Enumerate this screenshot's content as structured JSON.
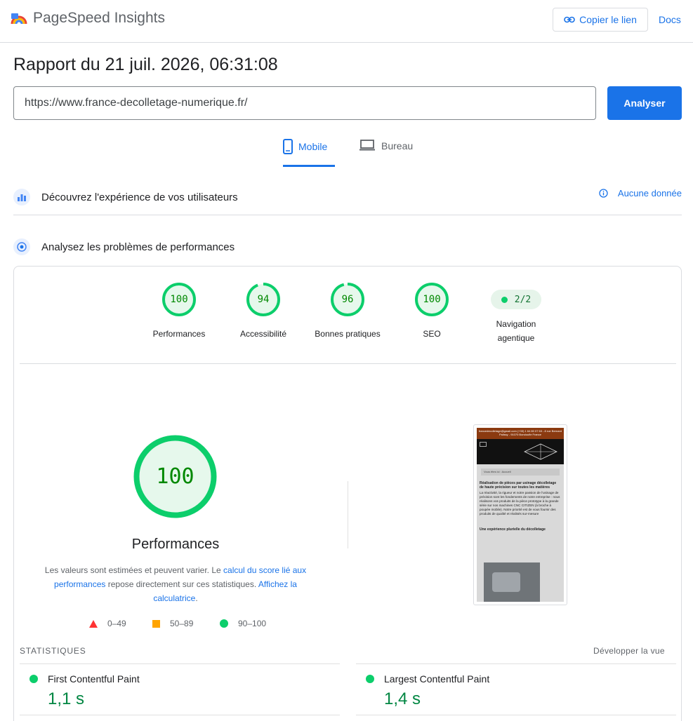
{
  "header": {
    "brand": "PageSpeed Insights",
    "copy_link": "Copier le lien",
    "docs": "Docs"
  },
  "report": {
    "title": "Rapport du 21 juil. 2026, 06:31:08",
    "url": "https://www.france-decolletage-numerique.fr/",
    "analyze": "Analyser"
  },
  "tabs": [
    {
      "label": "Mobile",
      "active": true,
      "icon": "smartphone-icon"
    },
    {
      "label": "Bureau",
      "active": false,
      "icon": "laptop-icon"
    }
  ],
  "sections": {
    "user_experience": {
      "title": "Découvrez l'expérience de vos utilisateurs",
      "status": "Aucune donnée"
    },
    "diagnose": {
      "title": "Analysez les problèmes de performances"
    }
  },
  "scores": [
    {
      "label": "Performances",
      "value": 100
    },
    {
      "label": "Accessibilité",
      "value": 94
    },
    {
      "label": "Bonnes pratiques",
      "value": 96
    },
    {
      "label": "SEO",
      "value": 100
    }
  ],
  "agentic": {
    "label_line1": "Navigation",
    "label_line2": "agentique",
    "value": "2/2"
  },
  "performance": {
    "score": "100",
    "title": "Performances",
    "note_start": "Les valeurs sont estimées et peuvent varier. Le ",
    "note_link1": "calcul du score lié aux performances",
    "note_mid": " repose directement sur ces statistiques. ",
    "note_link2": "Affichez la calculatrice",
    "note_end": ".",
    "legend": [
      "0–49",
      "50–89",
      "90–100"
    ]
  },
  "screenshot": {
    "top_line": "francedecolletage@gmail.com (+33) 1 64 80 07 63 - 8 rue Bernard Palissy - 91070 Bondoufle France",
    "breadcrumb": "Vous êtes ici : Accueil",
    "heading": "Réalisation de pièces par usinage décolletage de haute précision sur toutes les matières",
    "body": "La réactivité, la rigueur et notre passion de l'usinage de précision sont les fondements de notre entreprise : nous réalisons vos produits de la pièce prototype à la grande série sur nos machines CNC CITIZEN (à broche à poupée mobile). Notre priorité est de vous fournir des produits de qualité et réalisés sur-mesure",
    "subheading": "Une expérience plurielle du décolletage"
  },
  "stats": {
    "title": "STATISTIQUES",
    "expand": "Développer la vue",
    "items": [
      {
        "name": "First Contentful Paint",
        "value": "1,1 s"
      },
      {
        "name": "Largest Contentful Paint",
        "value": "1,4 s"
      }
    ]
  },
  "colors": {
    "accent": "#1a73e8",
    "pass": "#0cce6b",
    "pass_text": "#008800",
    "average": "#ffa400",
    "fail": "#ff3333"
  }
}
